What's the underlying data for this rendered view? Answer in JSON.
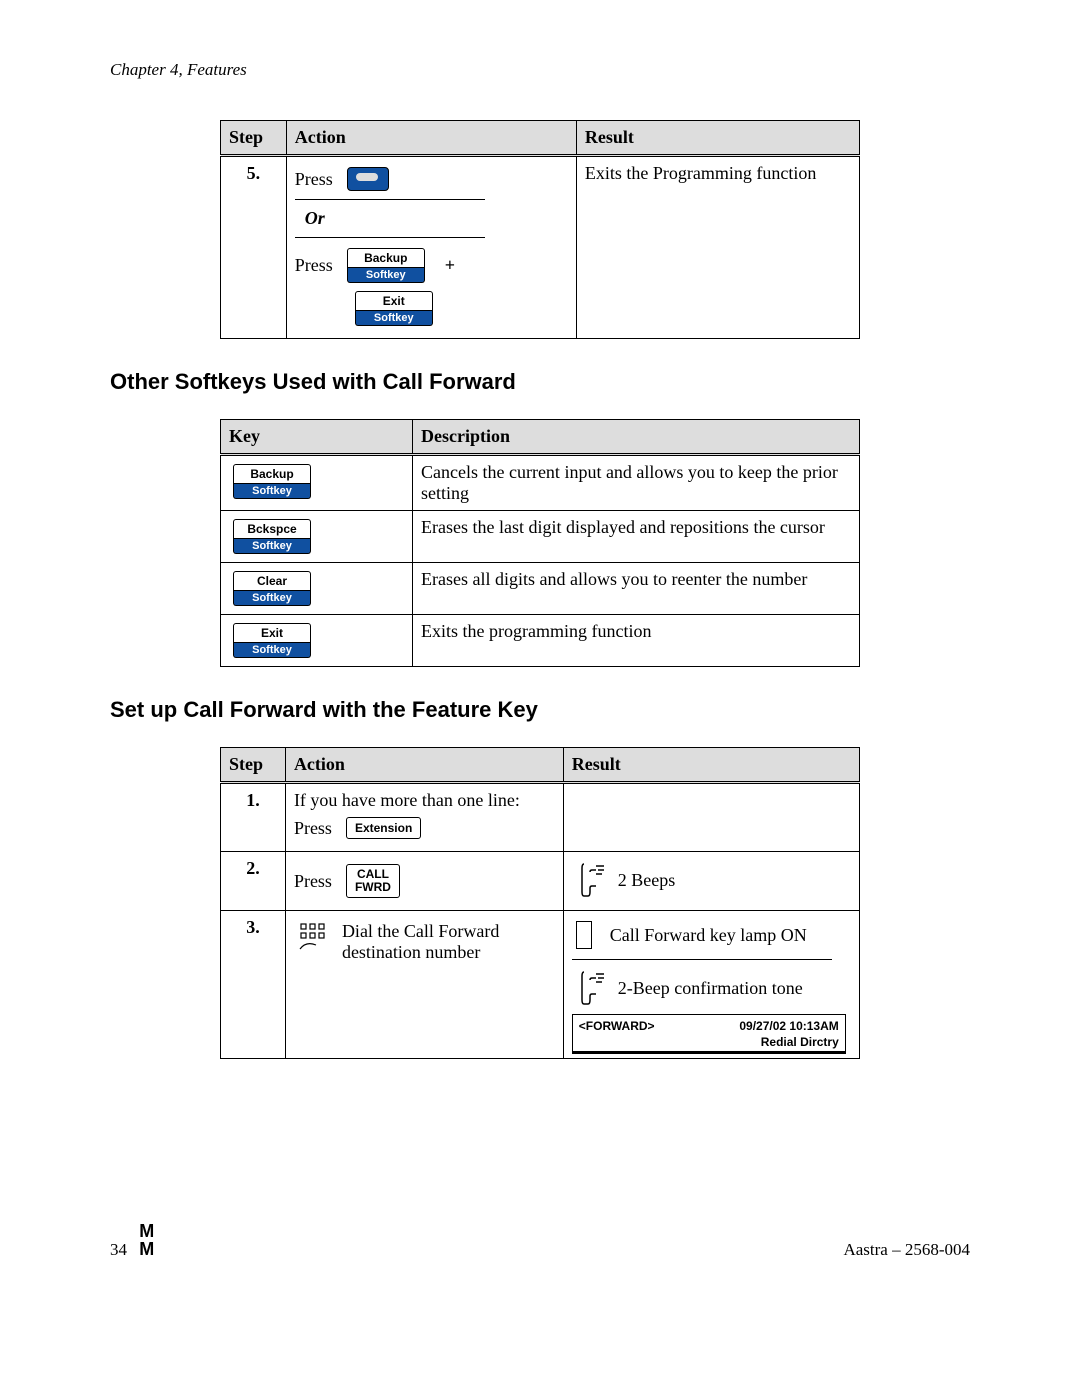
{
  "chapter": "Chapter 4, Features",
  "table1": {
    "headers": {
      "step": "Step",
      "action": "Action",
      "result": "Result"
    },
    "row": {
      "step": "5.",
      "press1": "Press",
      "or": "Or",
      "press2": "Press",
      "backup_label": "Backup",
      "softkey": "Softkey",
      "exit_label": "Exit",
      "plus": "+",
      "result": "Exits the Programming function"
    }
  },
  "section1": "Other Softkeys Used with Call Forward",
  "table2": {
    "headers": {
      "key": "Key",
      "desc": "Description"
    },
    "rows": [
      {
        "key": "Backup",
        "desc": "Cancels the current input and allows you to keep the prior setting"
      },
      {
        "key": "Bckspce",
        "desc": "Erases the last digit displayed and repositions the cursor"
      },
      {
        "key": "Clear",
        "desc": "Erases all digits and allows you to reenter the number"
      },
      {
        "key": "Exit",
        "desc": "Exits the programming function"
      }
    ],
    "softkey": "Softkey"
  },
  "section2": "Set up Call Forward with the Feature Key",
  "table3": {
    "headers": {
      "step": "Step",
      "action": "Action",
      "result": "Result"
    },
    "rows": [
      {
        "step": "1.",
        "pre": "If you have more than one line:",
        "press": "Press",
        "key": "Extension",
        "result": ""
      },
      {
        "step": "2.",
        "press": "Press",
        "key": "CALL\nFWRD",
        "result": "2 Beeps"
      },
      {
        "step": "3.",
        "action": "Dial the Call Forward destination number",
        "result1": "Call Forward key lamp ON",
        "result2": "2-Beep confirmation tone",
        "lcd_left": "<FORWARD>",
        "lcd_right": "09/27/02 10:13AM",
        "lcd_line2": "Redial  Dirctry"
      }
    ]
  },
  "footer": {
    "page": "34",
    "logo1": "M",
    "logo2": "M",
    "doc": "Aastra – 2568-004"
  }
}
